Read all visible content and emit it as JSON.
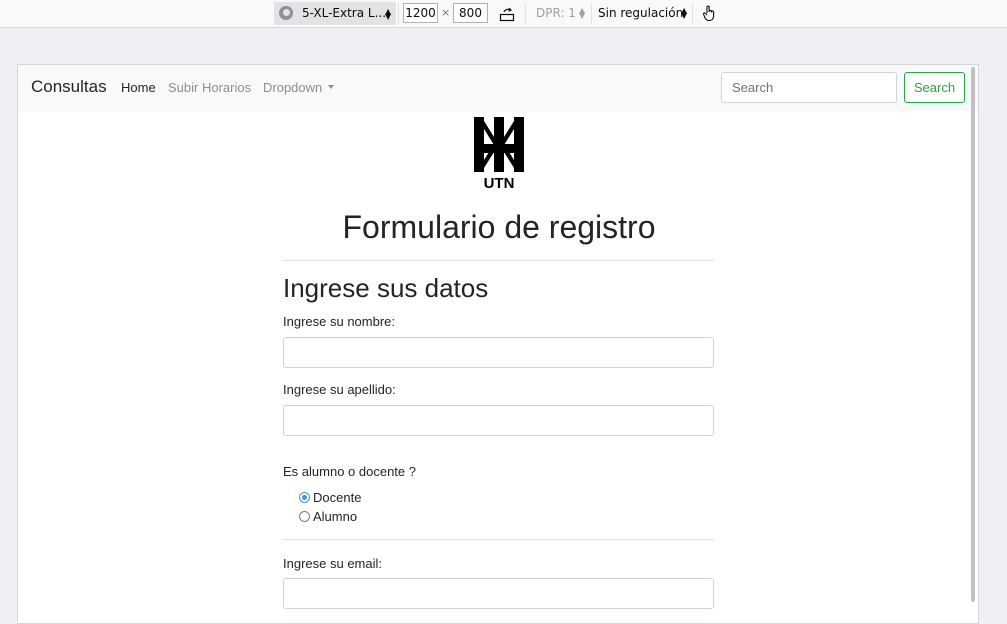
{
  "toolbar": {
    "device": "5-XL-Extra L...",
    "width": "1200",
    "times": "×",
    "height": "800",
    "dpr": "DPR: 1",
    "throttling": "Sin regulación"
  },
  "navbar": {
    "brand": "Consultas",
    "links": [
      {
        "label": "Home",
        "active": true
      },
      {
        "label": "Subir Horarios",
        "active": false
      },
      {
        "label": "Dropdown",
        "active": false
      }
    ],
    "search_placeholder": "Search",
    "search_button": "Search"
  },
  "logo": {
    "text": "UTN"
  },
  "form": {
    "title": "Formulario de registro",
    "section_title": "Ingrese sus datos",
    "nombre_label": "Ingrese su nombre:",
    "nombre_value": "",
    "apellido_label": "Ingrese su apellido:",
    "apellido_value": "",
    "role_question": "Es alumno o docente ?",
    "roles": [
      {
        "label": "Docente",
        "checked": true
      },
      {
        "label": "Alumno",
        "checked": false
      }
    ],
    "email_label": "Ingrese su email:",
    "email_value": ""
  },
  "colors": {
    "accent_green": "#28a745",
    "radio_checked": "#4a90d9",
    "navbar_bg": "#f8f9fa"
  }
}
